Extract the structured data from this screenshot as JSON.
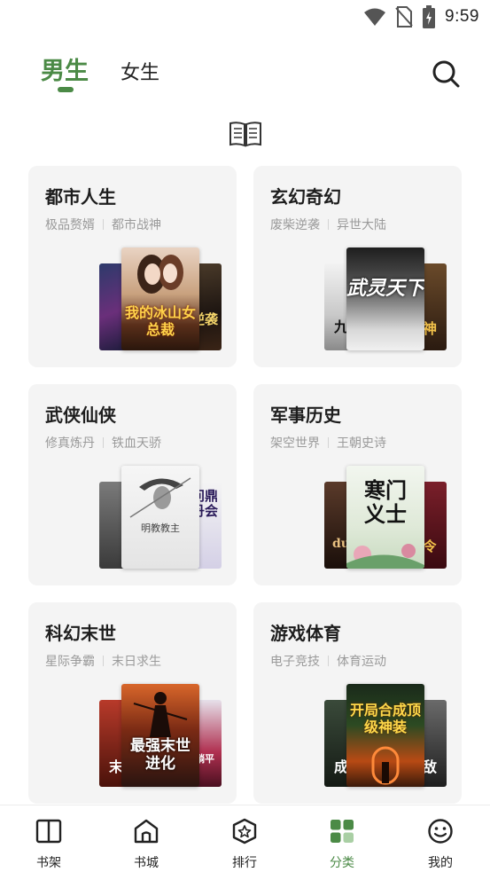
{
  "status_bar": {
    "time": "9:59"
  },
  "header": {
    "tabs": [
      {
        "label": "男生",
        "active": true
      },
      {
        "label": "女生",
        "active": false
      }
    ]
  },
  "categories": [
    {
      "title": "都市人生",
      "tags": [
        "极品赘婿",
        "都市战神"
      ],
      "cover_text": "我的冰山女总裁",
      "side_right_text": "逆袭"
    },
    {
      "title": "玄幻奇幻",
      "tags": [
        "废柴逆袭",
        "异世大陆"
      ],
      "cover_text": "武灵天下",
      "side_left_text": "九",
      "side_right_text": "神"
    },
    {
      "title": "武侠仙侠",
      "tags": [
        "修真炼丹",
        "铁血天骄"
      ],
      "cover_text": "明教教主",
      "side_right_text": "问鼎丹会"
    },
    {
      "title": "军事历史",
      "tags": [
        "架空世界",
        "王朝史诗"
      ],
      "cover_text": "寒门义士",
      "side_left_text": "du",
      "side_right_text": "令"
    },
    {
      "title": "科幻末世",
      "tags": [
        "星际争霸",
        "末日求生"
      ],
      "cover_text": "最强末世进化",
      "side_left_text": "末",
      "side_right_text": "躺平"
    },
    {
      "title": "游戏体育",
      "tags": [
        "电子竞技",
        "体育运动"
      ],
      "cover_text": "开局合成顶级神装",
      "side_left_text": "成",
      "side_right_text": "敌"
    }
  ],
  "bottom_nav": [
    {
      "label": "书架",
      "icon": "bookshelf-icon",
      "active": false
    },
    {
      "label": "书城",
      "icon": "bookstore-icon",
      "active": false
    },
    {
      "label": "排行",
      "icon": "ranking-icon",
      "active": false
    },
    {
      "label": "分类",
      "icon": "category-icon",
      "active": true
    },
    {
      "label": "我的",
      "icon": "profile-icon",
      "active": false
    }
  ],
  "colors": {
    "accent": "#4b8a46",
    "card_bg": "#f4f4f4",
    "tag_text": "#9a9a9a"
  }
}
